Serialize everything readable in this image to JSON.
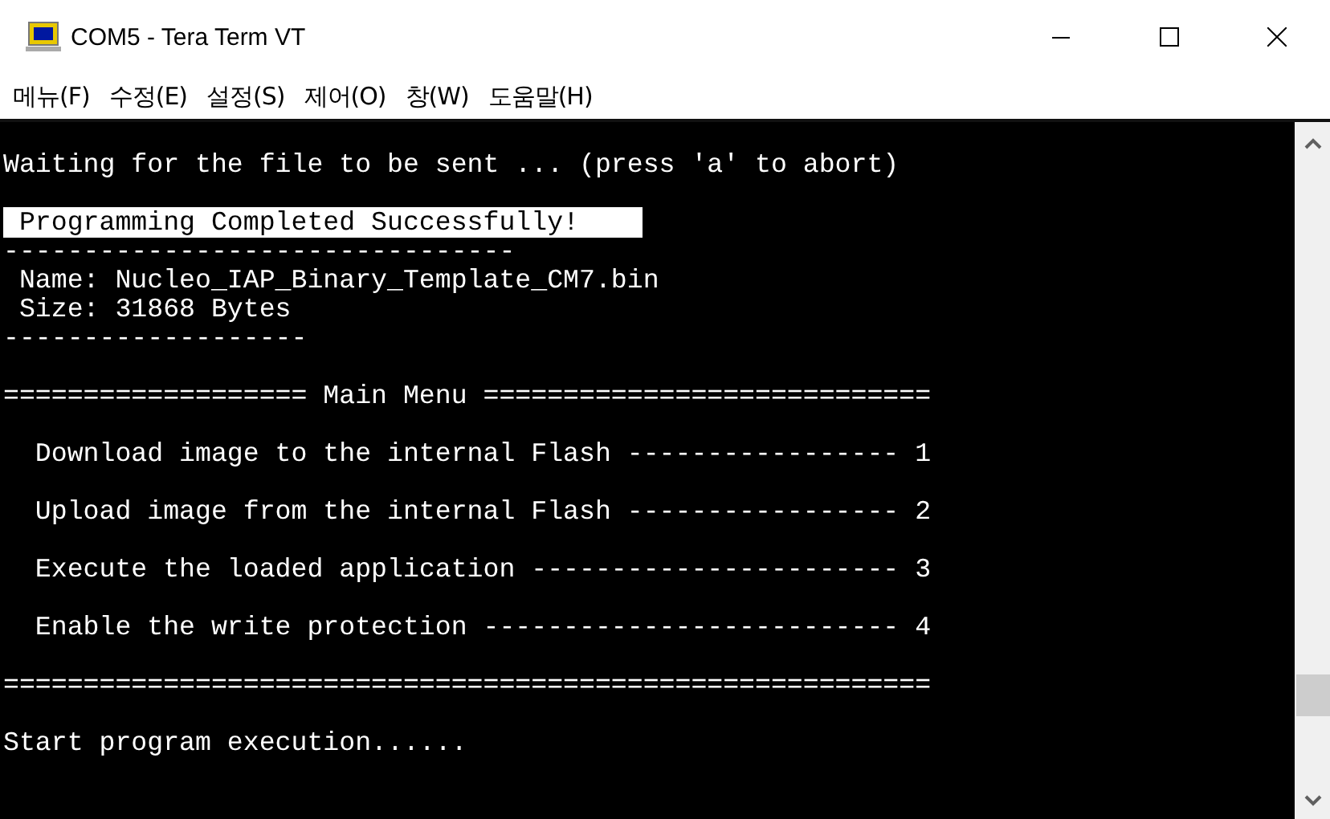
{
  "window": {
    "title": "COM5 - Tera Term VT"
  },
  "menu": [
    "메뉴(F)",
    "수정(E)",
    "설정(S)",
    "제어(O)",
    "창(W)",
    "도움말(H)"
  ],
  "terminal": {
    "lines": [
      {
        "kind": "blank"
      },
      {
        "kind": "text",
        "text": "Waiting for the file to be sent ... (press 'a' to abort)"
      },
      {
        "kind": "blank"
      },
      {
        "kind": "highlight",
        "text": " Programming Completed Successfully!    "
      },
      {
        "kind": "text",
        "text": "--------------------------------"
      },
      {
        "kind": "text",
        "text": " Name: Nucleo_IAP_Binary_Template_CM7.bin"
      },
      {
        "kind": "text",
        "text": " Size: 31868 Bytes"
      },
      {
        "kind": "text",
        "text": "-------------------"
      },
      {
        "kind": "blank"
      },
      {
        "kind": "text",
        "text": "=================== Main Menu ============================"
      },
      {
        "kind": "blank"
      },
      {
        "kind": "text",
        "text": "  Download image to the internal Flash ----------------- 1"
      },
      {
        "kind": "blank"
      },
      {
        "kind": "text",
        "text": "  Upload image from the internal Flash ----------------- 2"
      },
      {
        "kind": "blank"
      },
      {
        "kind": "text",
        "text": "  Execute the loaded application ----------------------- 3"
      },
      {
        "kind": "blank"
      },
      {
        "kind": "text",
        "text": "  Enable the write protection -------------------------- 4"
      },
      {
        "kind": "blank"
      },
      {
        "kind": "text",
        "text": "=========================================================="
      },
      {
        "kind": "blank"
      },
      {
        "kind": "text",
        "text": "Start program execution......"
      }
    ]
  }
}
